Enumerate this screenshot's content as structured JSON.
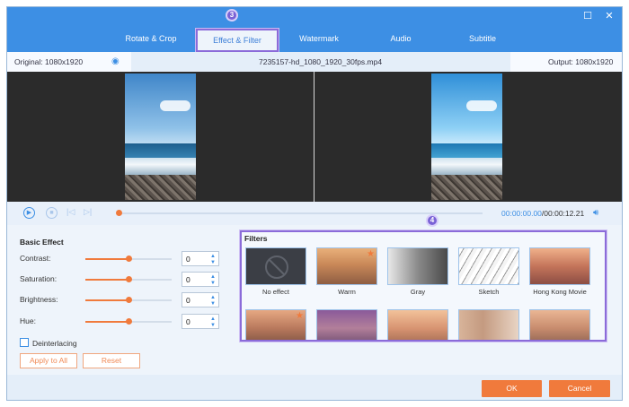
{
  "tabs": [
    {
      "label": "Rotate & Crop"
    },
    {
      "label": "Effect & Filter"
    },
    {
      "label": "Watermark"
    },
    {
      "label": "Audio"
    },
    {
      "label": "Subtitle"
    }
  ],
  "active_tab": "Effect & Filter",
  "annotations": {
    "tab_badge": "3",
    "filters_badge": "4"
  },
  "info": {
    "original": "Original: 1080x1920",
    "filename": "7235157-hd_1080_1920_30fps.mp4",
    "output": "Output: 1080x1920"
  },
  "playback": {
    "current": "00:00:00.00",
    "separator": "/",
    "duration": "00:00:12.21",
    "progress_fraction": 0.0
  },
  "basic_effect": {
    "title": "Basic Effect",
    "controls": [
      {
        "label": "Contrast:",
        "value": "0",
        "level": 0.5
      },
      {
        "label": "Saturation:",
        "value": "0",
        "level": 0.5
      },
      {
        "label": "Brightness:",
        "value": "0",
        "level": 0.5
      },
      {
        "label": "Hue:",
        "value": "0",
        "level": 0.5
      }
    ],
    "deinterlacing_label": "Deinterlacing",
    "deinterlacing_checked": false,
    "apply_all_label": "Apply to All",
    "reset_label": "Reset"
  },
  "filters": {
    "title": "Filters",
    "items": [
      {
        "name": "No effect"
      },
      {
        "name": "Warm"
      },
      {
        "name": "Gray"
      },
      {
        "name": "Sketch"
      },
      {
        "name": "Hong Kong Movie"
      }
    ]
  },
  "footer": {
    "ok_label": "OK",
    "cancel_label": "Cancel"
  },
  "colors": {
    "accent": "#3d8fe4",
    "orange": "#f07a3c",
    "highlight": "#8b6bd9"
  }
}
